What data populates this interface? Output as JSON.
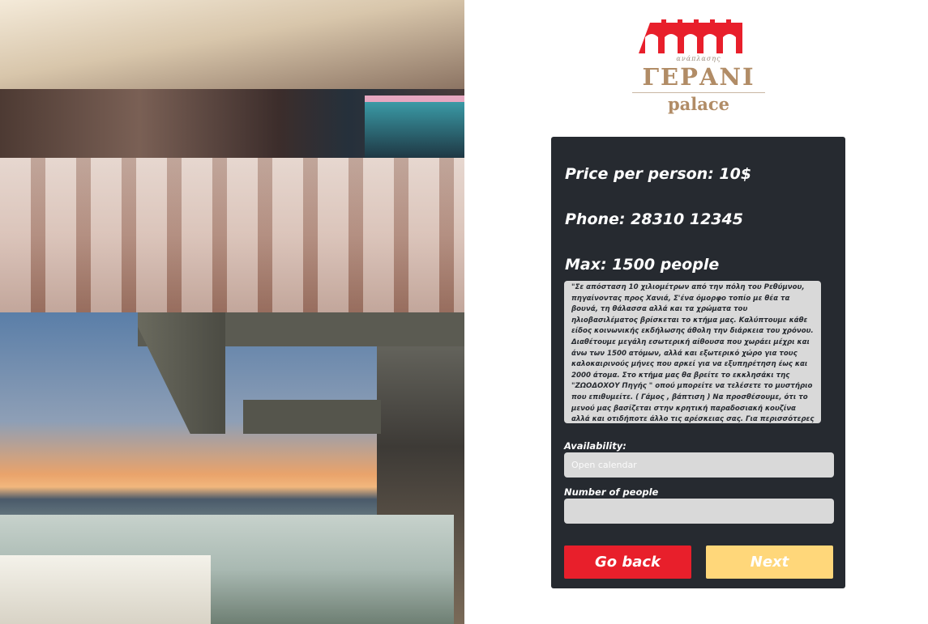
{
  "logo": {
    "small_text": "ανάπλασης",
    "name": "ΓΕΡΑΝΙ",
    "sub": "palace",
    "color": "#b18c66",
    "icon_color": "#e81f2b"
  },
  "venue": {
    "price": "Price per person: 10$",
    "phone": "Phone: 28310 12345",
    "max": "Max: 1500 people",
    "description": "\"Σε απόσταση 10 χιλιομέτρων από την πόλη του Ρεθύμνου, πηγαίνοντας προς Χανιά, Σ'ένα όμορφο τοπίο με θέα τα βουνά, τη θάλασσα αλλά και τα χρώματα του ηλιοβασιλέματος βρίσκεται το κτήμα μας. Καλύπτουμε κάθε είδος κοινωνικής εκδήλωσης άθολη την διάρκεια του χρόνου. Διαθέτουμε μεγάλη εσωτερική αίθουσα που χωράει μέχρι και άνω των 1500 ατόμων, αλλά και εξωτερικό χώρο για τους καλοκαιρινούς μήνες που αρκεί για να εξυπηρέτηση έως και 2000 άτομα. Στο κτήμα μας θα βρείτε το εκκλησάκι της \"ΖΩΟΔΟΧΟΥ Πηγής \" οπού μπορείτε να τελέσετε το μυστήριο που επιθυμείτε. ( Γάμος , βάπτιση ) Να προσθέσουμε, ότι το μενού μας βασίζεται στην κρητική παραδοσιακή κουζίνα αλλά και οτιδήποτε άλλο τις αρέσκειας σας. Για περισσότερες πληροφορίες επικοινωνήστε μαζί μας\""
  },
  "form": {
    "availability_label": "Availability:",
    "availability_placeholder": "Open calendar",
    "people_label": "Number of people",
    "people_value": ""
  },
  "buttons": {
    "back": "Go back",
    "next": "Next"
  },
  "colors": {
    "panel": "#262a30",
    "back_button": "#e81f2b",
    "next_button": "#ffd77a",
    "field": "#d9d9d9"
  }
}
